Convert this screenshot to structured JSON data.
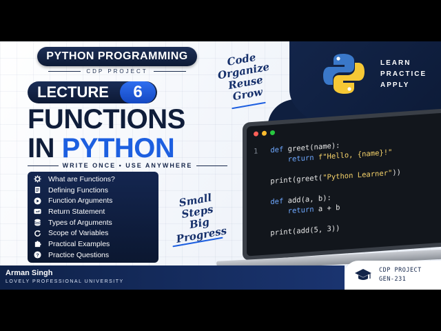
{
  "header": {
    "title": "PYTHON PROGRAMMING",
    "subtitle": "CDP PROJECT"
  },
  "lecture": {
    "label": "LECTURE",
    "number": "6"
  },
  "main_title": {
    "line1": "FUNCTIONS",
    "line2_prefix": "IN ",
    "line2_highlight": "PYTHON"
  },
  "tagline": "WRITE ONCE • USE ANYWHERE",
  "topics": [
    {
      "icon": "gear-icon",
      "label": "What are Functions?"
    },
    {
      "icon": "document-icon",
      "label": "Defining Functions"
    },
    {
      "icon": "play-icon",
      "label": "Function Arguments"
    },
    {
      "icon": "return-arrow-icon",
      "label": "Return Statement"
    },
    {
      "icon": "database-icon",
      "label": "Types of Arguments"
    },
    {
      "icon": "refresh-icon",
      "label": "Scope of Variables"
    },
    {
      "icon": "puzzle-icon",
      "label": "Practical Examples"
    },
    {
      "icon": "question-icon",
      "label": "Practice Questions"
    }
  ],
  "script_top": [
    "Code",
    "Organize",
    "Reuse",
    "Grow"
  ],
  "script_bottom": [
    "Small",
    "Steps",
    "Big Progress"
  ],
  "side_words": [
    "LEARN",
    "PRACTICE",
    "APPLY"
  ],
  "code": {
    "line_number": "1",
    "lines": [
      {
        "kw": "def ",
        "text": "greet(name):"
      },
      {
        "indent": "    ",
        "kw": "return ",
        "str": "f\"Hello, {name}!\""
      },
      {
        "text": ""
      },
      {
        "text": "print(greet(",
        "str": "\"Python Learner\"",
        "tail": "))"
      },
      {
        "text": ""
      },
      {
        "kw": "def ",
        "text": "add(a, b):"
      },
      {
        "indent": "    ",
        "kw": "return ",
        "text": "a + b"
      },
      {
        "text": ""
      },
      {
        "text": "print(add(5, 3))"
      }
    ]
  },
  "footer": {
    "author": "Arman Singh",
    "university": "LOVELY PROFESSIONAL UNIVERSITY",
    "badge_line1": "CDP PROJECT",
    "badge_line2": "GEN-231"
  },
  "colors": {
    "navy": "#13254a",
    "accent_blue": "#1d5fe0",
    "python_blue": "#3a78c9",
    "python_yellow": "#f6c835"
  }
}
